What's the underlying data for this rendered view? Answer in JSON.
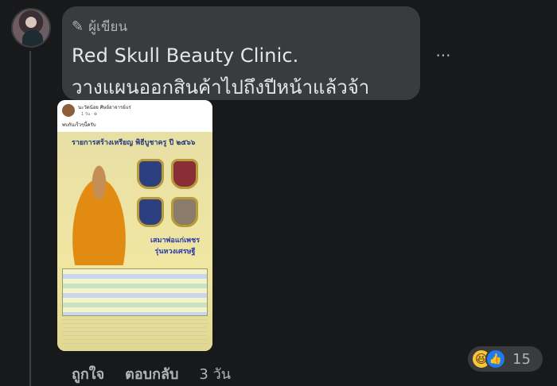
{
  "comment": {
    "author_badge": "ผู้เขียน",
    "author_name": "Red Skull Beauty Clinic.",
    "text": "วางแผนออกสินค้าไปถึงปีหน้าแล้วจ้า",
    "more_label": "..."
  },
  "attachment": {
    "post_author": "นะวัดน้อย ศิษย์อาจารย์แร่",
    "post_time": "1 วัน · ⊕",
    "post_caption": "พบกันเร็วๆนี้ครับ",
    "poster_title": "รายการสร้างเหรียญ พิธีบูชาครู ปี ๒๕๖๖",
    "poster_name_line1": "เสมาพ่อแก่เพชร",
    "poster_name_line2": "รุ่นหวงเศรษฐี"
  },
  "actions": {
    "like": "ถูกใจ",
    "reply": "ตอบกลับ",
    "time": "3 วัน"
  },
  "reactions": {
    "count": "15",
    "icons": [
      "haha-icon",
      "like-icon"
    ]
  }
}
